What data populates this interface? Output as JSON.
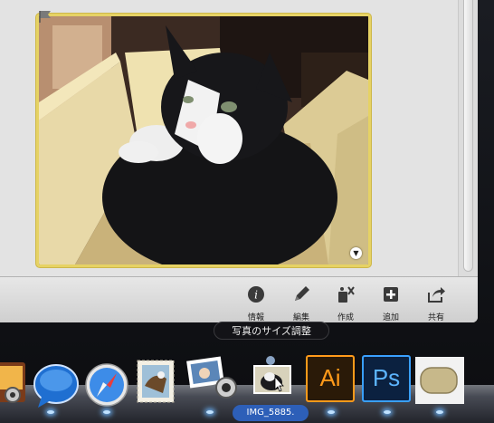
{
  "toolbar": {
    "items": [
      {
        "label": "情報",
        "icon": "info-icon"
      },
      {
        "label": "編集",
        "icon": "pencil-icon"
      },
      {
        "label": "作成",
        "icon": "create-icon"
      },
      {
        "label": "追加",
        "icon": "add-icon"
      },
      {
        "label": "共有",
        "icon": "share-icon"
      }
    ]
  },
  "photo": {
    "subject": "cat-in-box-photo",
    "frame_color": "#e6d264"
  },
  "dock": {
    "tooltip": "写真のサイズ調整",
    "dragged_file_label": "IMG_5885.",
    "apps": [
      {
        "icon": "photo-booth-icon"
      },
      {
        "icon": "messages-icon"
      },
      {
        "icon": "safari-icon"
      },
      {
        "icon": "mail-stamp-icon"
      },
      {
        "icon": "iphoto-icon"
      },
      {
        "icon": "dragged-photo-icon"
      },
      {
        "icon": "illustrator-icon",
        "label": "Ai"
      },
      {
        "icon": "photoshop-icon",
        "label": "Ps"
      },
      {
        "icon": "stickies-icon"
      }
    ]
  }
}
